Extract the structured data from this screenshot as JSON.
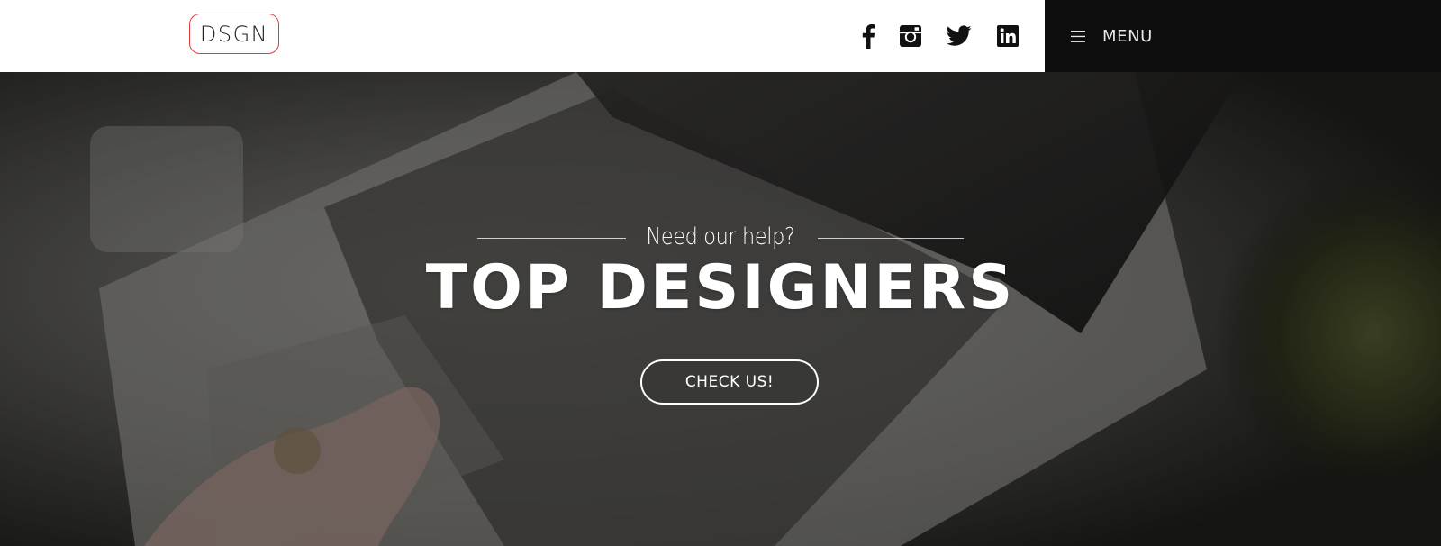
{
  "header": {
    "logo_text": "DSGN",
    "social": [
      {
        "name": "facebook-icon"
      },
      {
        "name": "instagram-icon"
      },
      {
        "name": "twitter-icon"
      },
      {
        "name": "linkedin-icon"
      }
    ],
    "menu_label": "MENU",
    "menu_icon": "hamburger-icon"
  },
  "hero": {
    "tagline": "Need our help?",
    "headline": "TOP DESIGNERS",
    "cta_label": "CHECK US!"
  },
  "colors": {
    "logo_border": "#e23b3b",
    "menu_background": "#0e0e0e",
    "header_background": "#ffffff",
    "hero_text": "#ffffff"
  }
}
